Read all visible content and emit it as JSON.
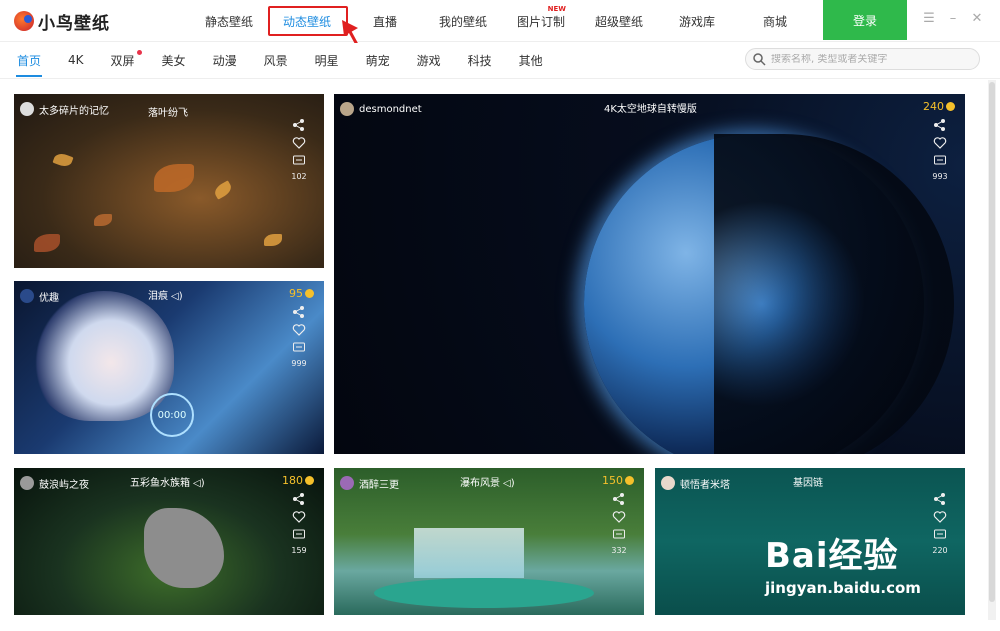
{
  "app": {
    "logo_text": "小鸟壁纸"
  },
  "nav": {
    "items": [
      {
        "label": "静态壁纸"
      },
      {
        "label": "动态壁纸",
        "active": true
      },
      {
        "label": "直播"
      },
      {
        "label": "我的壁纸"
      },
      {
        "label": "图片订制",
        "badge": "NEW"
      },
      {
        "label": "超级壁纸"
      },
      {
        "label": "游戏库"
      },
      {
        "label": "商城"
      }
    ],
    "login_label": "登录",
    "window_controls": [
      "menu-icon",
      "minimize-icon",
      "close-icon"
    ]
  },
  "categories": [
    {
      "label": "首页",
      "active": true
    },
    {
      "label": "4K"
    },
    {
      "label": "双屏",
      "dot": true
    },
    {
      "label": "美女"
    },
    {
      "label": "动漫"
    },
    {
      "label": "风景"
    },
    {
      "label": "明星"
    },
    {
      "label": "萌宠"
    },
    {
      "label": "游戏"
    },
    {
      "label": "科技"
    },
    {
      "label": "其他"
    }
  ],
  "search": {
    "placeholder": "搜索名称, 类型或者关键字"
  },
  "tiles": [
    {
      "author": "太多碎片的记忆",
      "title": "落叶纷飞",
      "comments": "102"
    },
    {
      "author": "desmondnet",
      "title": "4K太空地球自转慢版",
      "coins": "240",
      "comments": "993"
    },
    {
      "author": "优趣",
      "title": "泪痕",
      "coins": "95",
      "comments": "999",
      "overlay_text": "00:00"
    },
    {
      "author": "鼓浪屿之夜",
      "title": "五彩鱼水族箱",
      "coins": "180",
      "comments": "159"
    },
    {
      "author": "酒醉三更",
      "title": "瀑布风景",
      "coins": "150",
      "comments": "332"
    },
    {
      "author": "顿悟者米塔",
      "title": "基因链",
      "comments": "220"
    }
  ],
  "watermark": {
    "logo": "Bai经验",
    "url": "jingyan.baidu.com"
  },
  "colors": {
    "accent": "#1d8ce0",
    "login": "#2fb94b",
    "highlight_box": "#e02020",
    "coin": "#f5c02b"
  }
}
